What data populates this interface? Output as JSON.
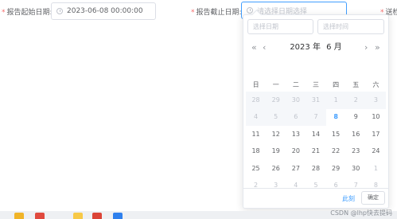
{
  "form": {
    "start_label": "报告起始日期:",
    "start_value": "2023-06-08 00:00:00",
    "end_label": "报告截止日期:",
    "end_placeholder": "请选择日期选择",
    "third_label": "送检",
    "required_mark": "*"
  },
  "picker": {
    "date_placeholder": "选择日期",
    "time_placeholder": "选择时间",
    "year_label": "2023 年",
    "month_label": "6 月",
    "prev_year": "«",
    "prev_month": "‹",
    "next_month": "›",
    "next_year": "»",
    "weekdays": [
      "日",
      "一",
      "二",
      "三",
      "四",
      "五",
      "六"
    ],
    "weeks": [
      [
        {
          "d": "28",
          "t": "prev-disabled"
        },
        {
          "d": "29",
          "t": "prev-disabled"
        },
        {
          "d": "30",
          "t": "prev-disabled"
        },
        {
          "d": "31",
          "t": "prev-disabled"
        },
        {
          "d": "1",
          "t": "disabled"
        },
        {
          "d": "2",
          "t": "disabled"
        },
        {
          "d": "3",
          "t": "disabled"
        }
      ],
      [
        {
          "d": "4",
          "t": "disabled"
        },
        {
          "d": "5",
          "t": "disabled"
        },
        {
          "d": "6",
          "t": "disabled"
        },
        {
          "d": "7",
          "t": "disabled"
        },
        {
          "d": "8",
          "t": "today"
        },
        {
          "d": "9",
          "t": "cur"
        },
        {
          "d": "10",
          "t": "cur"
        }
      ],
      [
        {
          "d": "11",
          "t": "cur"
        },
        {
          "d": "12",
          "t": "cur"
        },
        {
          "d": "13",
          "t": "cur"
        },
        {
          "d": "14",
          "t": "cur"
        },
        {
          "d": "15",
          "t": "cur"
        },
        {
          "d": "16",
          "t": "cur"
        },
        {
          "d": "17",
          "t": "cur"
        }
      ],
      [
        {
          "d": "18",
          "t": "cur"
        },
        {
          "d": "19",
          "t": "cur"
        },
        {
          "d": "20",
          "t": "cur"
        },
        {
          "d": "21",
          "t": "cur"
        },
        {
          "d": "22",
          "t": "cur"
        },
        {
          "d": "23",
          "t": "cur"
        },
        {
          "d": "24",
          "t": "cur"
        }
      ],
      [
        {
          "d": "25",
          "t": "cur"
        },
        {
          "d": "26",
          "t": "cur"
        },
        {
          "d": "27",
          "t": "cur"
        },
        {
          "d": "28",
          "t": "cur"
        },
        {
          "d": "29",
          "t": "cur"
        },
        {
          "d": "30",
          "t": "cur"
        },
        {
          "d": "1",
          "t": "next"
        }
      ],
      [
        {
          "d": "2",
          "t": "next"
        },
        {
          "d": "3",
          "t": "next"
        },
        {
          "d": "4",
          "t": "next"
        },
        {
          "d": "5",
          "t": "next"
        },
        {
          "d": "6",
          "t": "next"
        },
        {
          "d": "7",
          "t": "next"
        },
        {
          "d": "8",
          "t": "next"
        }
      ]
    ],
    "now_label": "此刻",
    "confirm_label": "确定"
  },
  "watermark": "CSDN @lhp快去提码",
  "colors": {
    "accent": "#409eff",
    "required": "#f56c6c",
    "border": "#dcdfe6",
    "muted": "#c0c4cc"
  },
  "taskbar_icons": [
    {
      "name": "file-manager-icon",
      "color": "#f0b429"
    },
    {
      "name": "notification-app-icon",
      "color": "#e04a3f"
    },
    {
      "name": "folder-icon",
      "color": "#f7c948"
    },
    {
      "name": "chrome-icon",
      "color": "#db4437"
    },
    {
      "name": "vscode-icon",
      "color": "#2f80ed"
    }
  ]
}
